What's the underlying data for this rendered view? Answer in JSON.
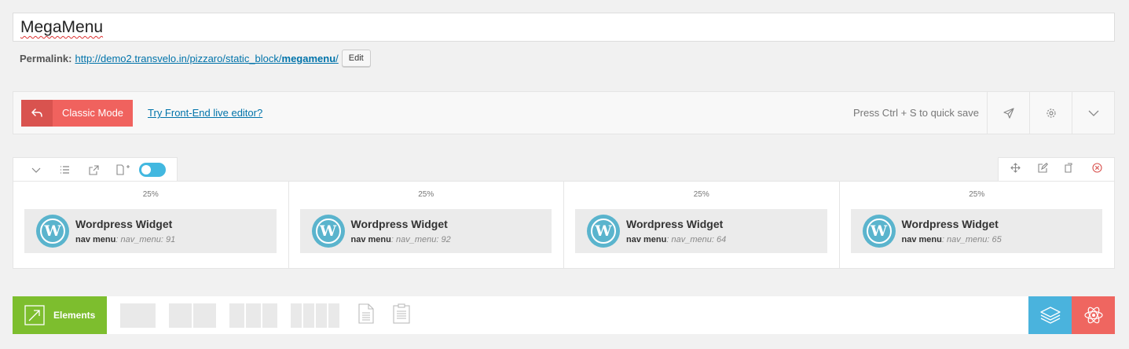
{
  "post": {
    "title": "MegaMenu",
    "permalink_label": "Permalink:",
    "permalink_url_base": "http://demo2.transvelo.in/pizzaro/static_block/",
    "permalink_slug": "megamenu",
    "permalink_trailing": "/",
    "edit_label": "Edit"
  },
  "composer_bar": {
    "classic_mode_label": "Classic Mode",
    "frontend_link": "Try Front-End live editor?",
    "quick_save_hint": "Press Ctrl + S to quick save",
    "icons": [
      "undo-icon",
      "send-icon",
      "gear-icon",
      "chevron-down-icon"
    ]
  },
  "row": {
    "toolbar_left_icons": [
      "chevron-down-icon",
      "list-icon",
      "export-icon",
      "add-page-icon",
      "toggle-switch"
    ],
    "toolbar_right_icons": [
      "move-icon",
      "edit-icon",
      "copy-icon",
      "delete-icon"
    ],
    "columns": [
      {
        "width": "25%",
        "widget_title": "Wordpress Widget",
        "param_label": "nav menu",
        "param_value": ": nav_menu: 91"
      },
      {
        "width": "25%",
        "widget_title": "Wordpress Widget",
        "param_label": "nav menu",
        "param_value": ": nav_menu: 92"
      },
      {
        "width": "25%",
        "widget_title": "Wordpress Widget",
        "param_label": "nav menu",
        "param_value": ": nav_menu: 64"
      },
      {
        "width": "25%",
        "widget_title": "Wordpress Widget",
        "param_label": "nav menu",
        "param_value": ": nav_menu: 65"
      }
    ]
  },
  "bottom_bar": {
    "elements_label": "Elements",
    "icons": [
      "add-element-icon",
      "layout-1-col",
      "layout-2-col",
      "layout-3-col",
      "layout-4-col",
      "text-block-icon",
      "template-icon",
      "layers-icon",
      "atom-icon"
    ]
  },
  "colors": {
    "classic_red": "#f0625e",
    "link_blue": "#0073aa",
    "elements_green": "#7dbe2e",
    "wp_blue": "#5ab4cd",
    "toggle_blue": "#42b8e0"
  }
}
